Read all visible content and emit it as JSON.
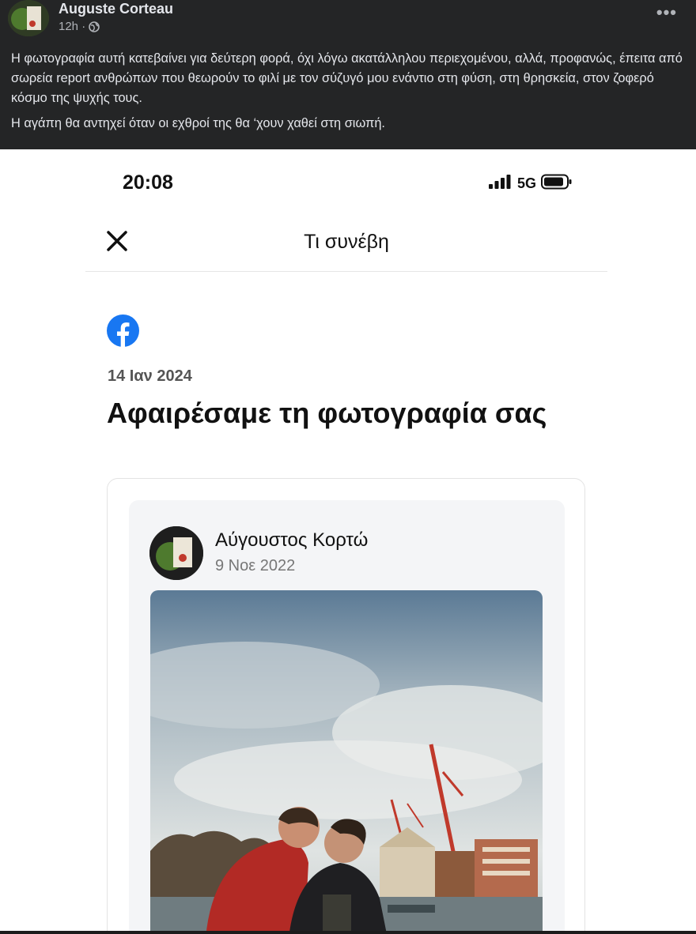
{
  "post": {
    "author": "Auguste Corteau",
    "time": "12h ·",
    "paragraphs": [
      "Η φωτογραφία αυτή κατεβαίνει για δεύτερη φορά, όχι λόγω ακατάλληλου περιεχομένου, αλλά, προφανώς, έπειτα από σωρεία report ανθρώπων που θεωρούν το φιλί με τον σύζυγό μου ενάντιο στη φύση, στη θρησκεία, στον ζοφερό κόσμο της ψυχής τους.",
      "Η αγάπη θα αντηχεί όταν οι εχθροί της θα ‘χουν χαθεί στη σιωπή."
    ],
    "more_label": "•••"
  },
  "phone": {
    "status": {
      "time": "20:08",
      "network": "5G"
    },
    "nav": {
      "title": "Τι συνέβη"
    },
    "notice": {
      "date": "14 Ιαν 2024",
      "title": "Αφαιρέσαμε τη φωτογραφία σας"
    },
    "removed_post": {
      "author": "Αύγουστος Κορτώ",
      "date": "9 Νοε 2022"
    }
  },
  "colors": {
    "dark_bg": "#242526",
    "facebook_blue": "#1877f2"
  }
}
